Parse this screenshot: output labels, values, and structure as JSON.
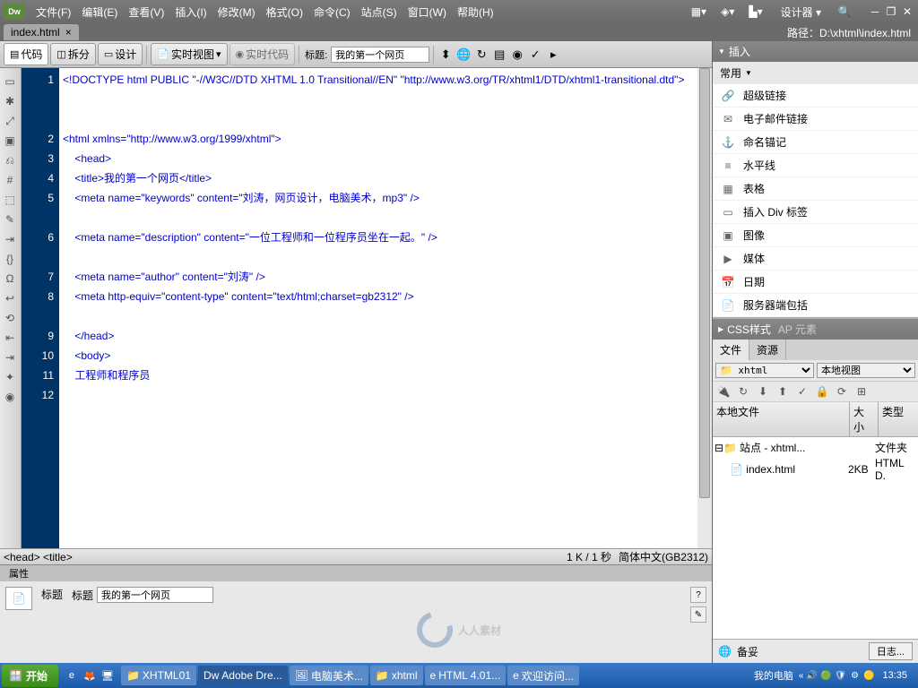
{
  "menubar": {
    "logo": "Dw",
    "items": [
      "文件(F)",
      "编辑(E)",
      "查看(V)",
      "插入(I)",
      "修改(M)",
      "格式(O)",
      "命令(C)",
      "站点(S)",
      "窗口(W)",
      "帮助(H)"
    ],
    "workspace": "设计器"
  },
  "tab": {
    "filename": "index.html",
    "close": "×"
  },
  "pathbar": {
    "label": "路径：",
    "value": "D:\\xhtml\\index.html"
  },
  "toolbar": {
    "code": "代码",
    "split": "拆分",
    "design": "设计",
    "liveview": "实时视图",
    "livecode": "实时代码",
    "title_label": "标题:",
    "title_value": "我的第一个网页"
  },
  "code_lines": [
    "<!DOCTYPE html PUBLIC \"-//W3C//DTD XHTML 1.0 Transitional//EN\" \"http://www.w3.org/TR/xhtml1/DTD/xhtml1-transitional.dtd\">",
    "<html xmlns=\"http://www.w3.org/1999/xhtml\">",
    "    <head>",
    "    <title>我的第一个网页</title>",
    "    <meta name=\"keywords\" content=\"刘涛，网页设计，电脑美术，mp3\" />",
    "    <meta name=\"description\" content=\"一位工程师和一位程序员坐在一起。\" />",
    "    <meta name=\"author\" content=\"刘涛\" />",
    "    <meta http-equiv=\"content-type\" content=\"text/html;charset=gb2312\" />",
    "    </head>",
    "    <body>",
    "    工程师和程序员",
    ""
  ],
  "statusbar": {
    "path": "<head> <title>",
    "size": "1 K / 1 秒",
    "encoding": "简体中文(GB2312)"
  },
  "properties": {
    "tab": "属性",
    "title_label": "标题",
    "title_sub": "标题",
    "title_input": "我的第一个网页"
  },
  "insert_panel": {
    "header": "插入",
    "category": "常用",
    "items": [
      "超级链接",
      "电子邮件链接",
      "命名锚记",
      "水平线",
      "表格",
      "插入 Div 标签",
      "图像",
      "媒体",
      "日期",
      "服务器端包括"
    ],
    "icons": [
      "🔗",
      "✉",
      "⚓",
      "≡",
      "▦",
      "▭",
      "▣",
      "▶",
      "📅",
      "📄"
    ]
  },
  "css_panel": {
    "header": "CSS样式",
    "ap": "AP 元素"
  },
  "files_panel": {
    "tabs": [
      "文件",
      "资源"
    ],
    "site_select": "xhtml",
    "view_select": "本地视图",
    "columns": [
      "本地文件",
      "大小",
      "类型"
    ],
    "tree": [
      {
        "indent": 0,
        "expand": "⊟",
        "icon": "folder",
        "name": "站点 - xhtml...",
        "size": "",
        "type": "文件夹"
      },
      {
        "indent": 1,
        "expand": "",
        "icon": "file",
        "name": "index.html",
        "size": "2KB",
        "type": "HTML D."
      }
    ],
    "ready": "备妥",
    "log_btn": "日志..."
  },
  "taskbar": {
    "start": "开始",
    "tasks": [
      {
        "icon": "📁",
        "label": "XHTML01"
      },
      {
        "icon": "Dw",
        "label": "Adobe Dre...",
        "active": true
      },
      {
        "icon": "🖼",
        "label": "电脑美术..."
      },
      {
        "icon": "📁",
        "label": "xhtml"
      },
      {
        "icon": "e",
        "label": "HTML 4.01..."
      },
      {
        "icon": "e",
        "label": "欢迎访问..."
      }
    ],
    "desktop": "我的电脑",
    "time": "13:35"
  },
  "watermark": "人人素材"
}
